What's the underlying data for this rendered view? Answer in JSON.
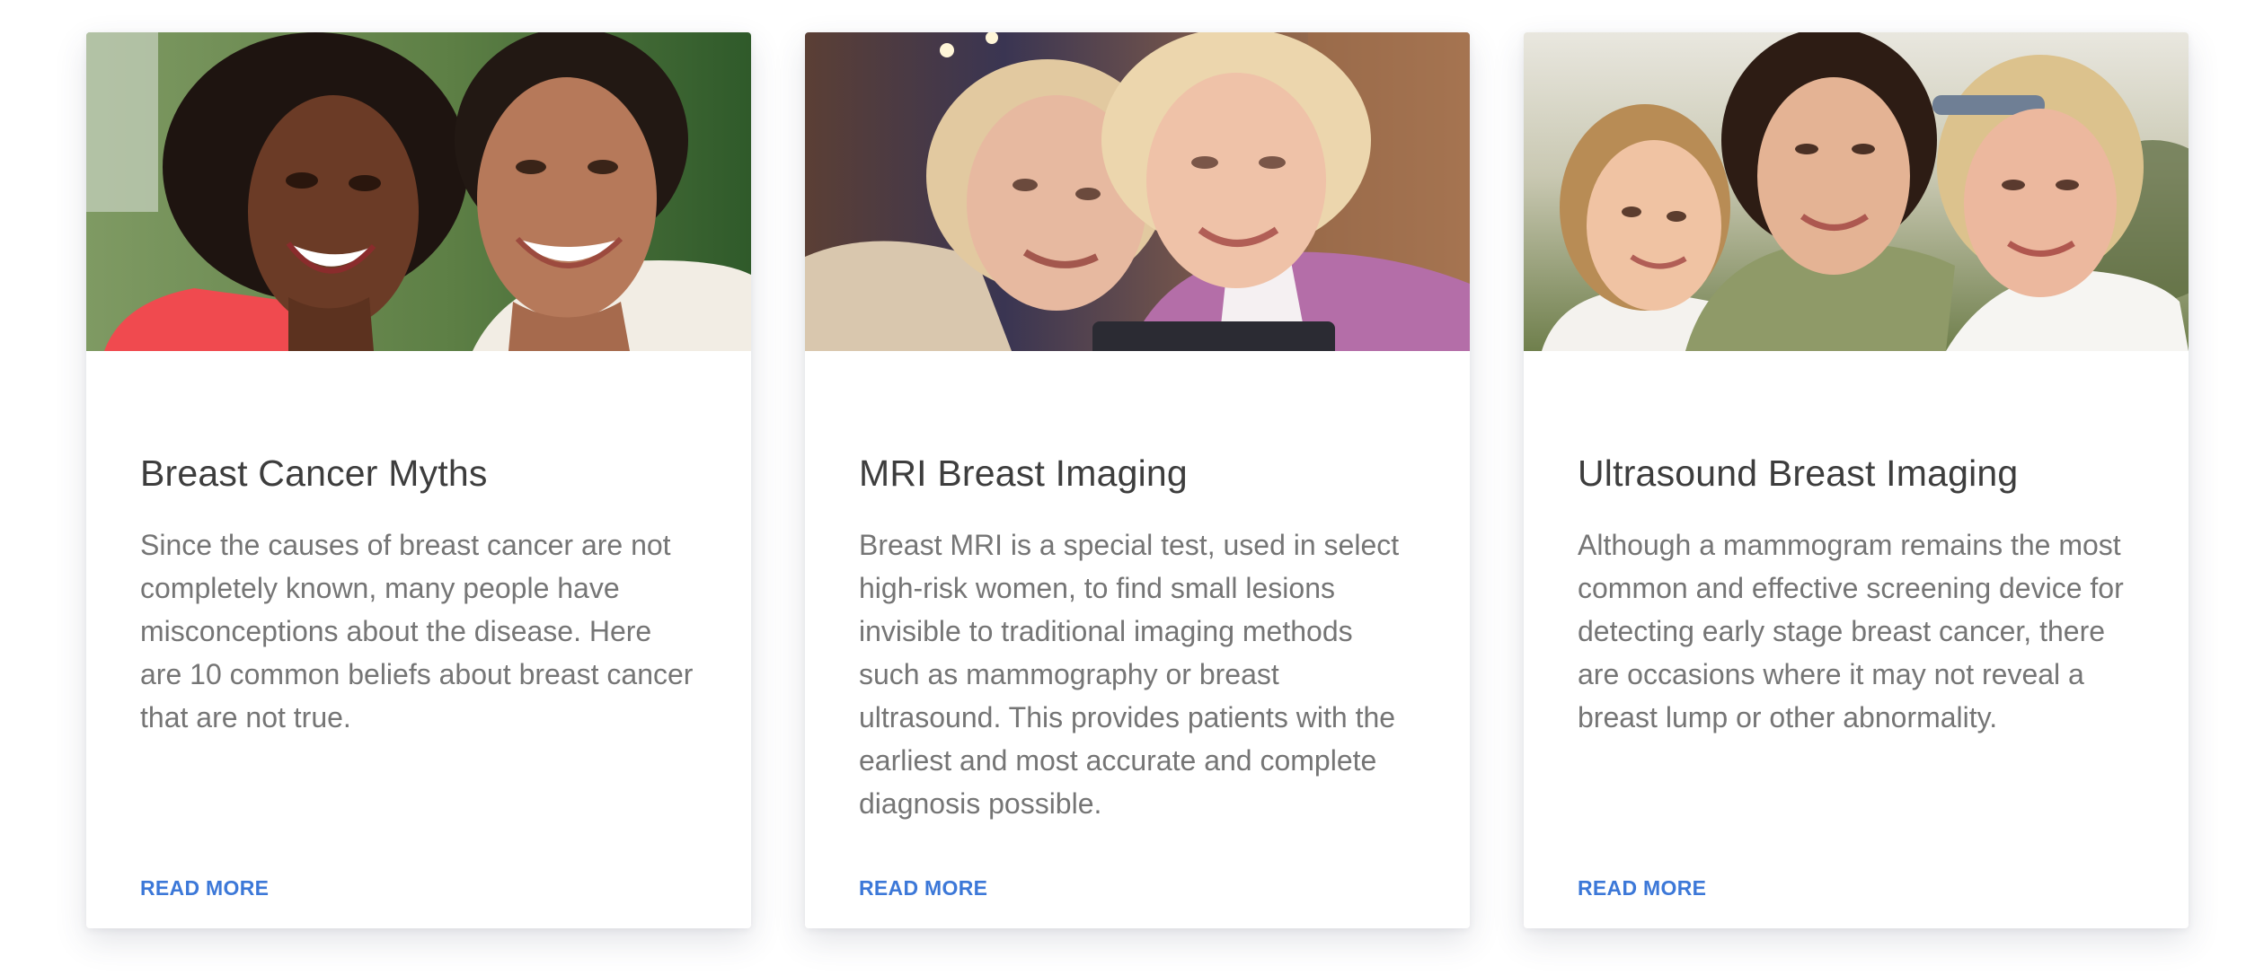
{
  "cards": [
    {
      "image_alt": "Two smiling women embracing outdoors",
      "title": "Breast Cancer Myths",
      "text": "Since the causes of breast cancer are not completely known, many people have misconceptions about the disease. Here are 10 common beliefs about breast cancer that are not true.",
      "link": "READ MORE"
    },
    {
      "image_alt": "Two older women smiling at a phone",
      "title": "MRI Breast Imaging",
      "text": "Breast MRI is a special test, used in select high-risk women, to find small lesions invisible to traditional imaging methods such as mammography or breast ultrasound. This provides patients with the earliest and most accurate and complete diagnosis possible.",
      "link": "READ MORE"
    },
    {
      "image_alt": "Girl, mother and grandmother smiling together",
      "title": "Ultrasound Breast Imaging",
      "text": "Although a mammogram remains the most common and effective screening device for detecting early stage breast cancer, there are occasions where it may not reveal a breast lump or other abnormality.",
      "link": "READ MORE"
    }
  ],
  "colors": {
    "title": "#3d3d3d",
    "body_text": "#757575",
    "link": "#3c78d8",
    "card_bg": "#ffffff"
  }
}
